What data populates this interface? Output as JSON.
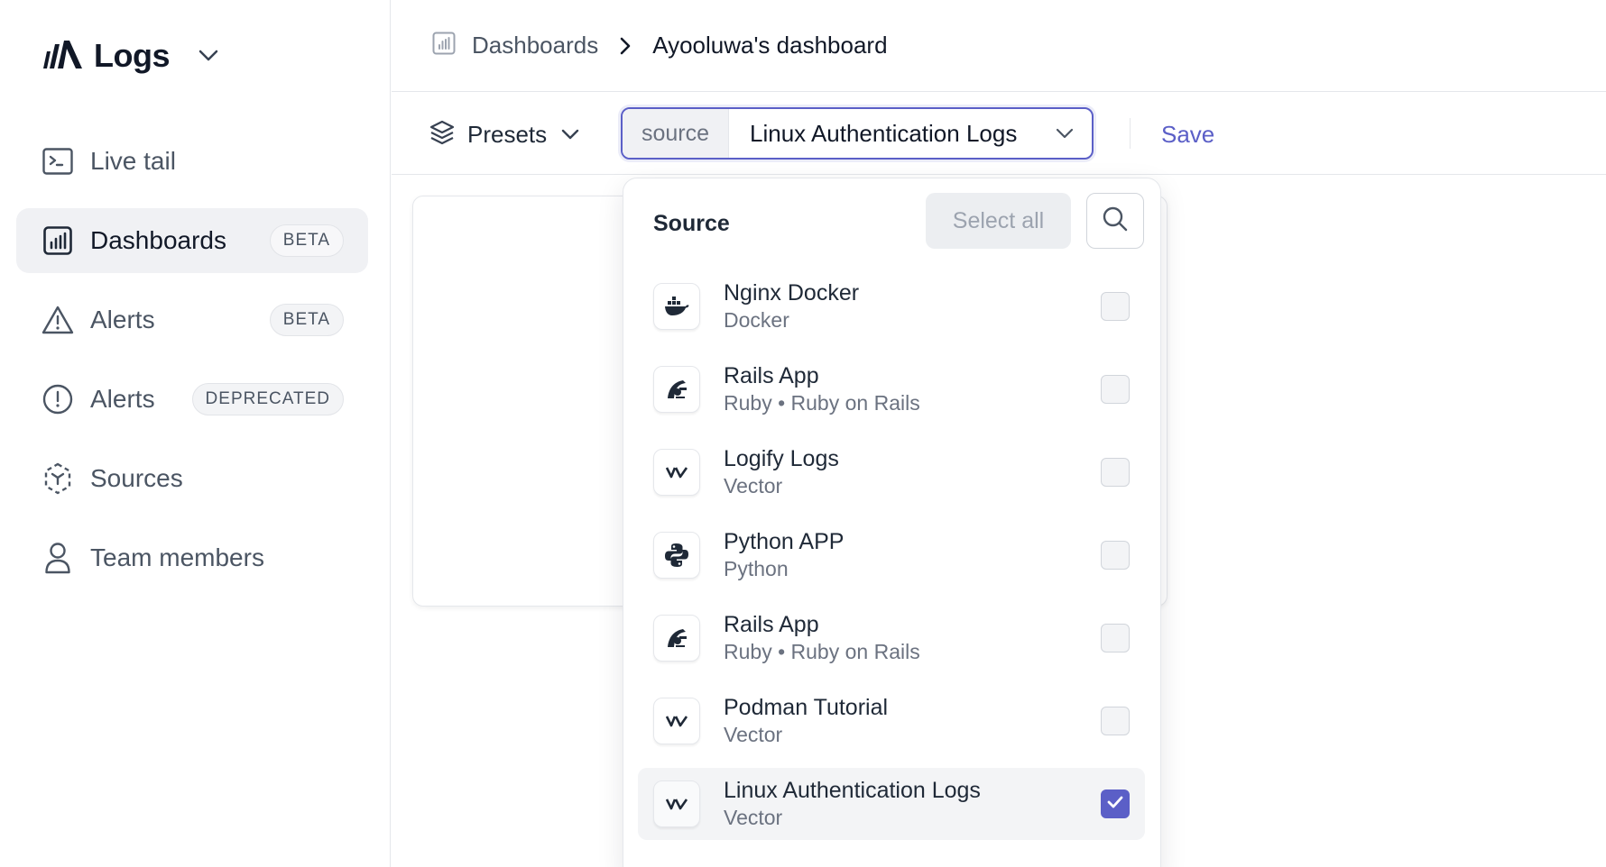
{
  "app": {
    "title": "Logs"
  },
  "sidebar": {
    "items": [
      {
        "label": "Live tail",
        "icon": "terminal-icon",
        "badge": "",
        "active": false
      },
      {
        "label": "Dashboards",
        "icon": "chart-icon",
        "badge": "BETA",
        "active": true
      },
      {
        "label": "Alerts",
        "icon": "warning-icon",
        "badge": "BETA",
        "active": false
      },
      {
        "label": "Alerts",
        "icon": "alert-circle-icon",
        "badge": "DEPRECATED",
        "active": false
      },
      {
        "label": "Sources",
        "icon": "sources-icon",
        "badge": "",
        "active": false
      },
      {
        "label": "Team members",
        "icon": "user-icon",
        "badge": "",
        "active": false
      }
    ]
  },
  "breadcrumb": {
    "parent": "Dashboards",
    "current": "Ayooluwa's dashboard"
  },
  "toolbar": {
    "presets_label": "Presets",
    "source_tag": "source",
    "source_value": "Linux Authentication Logs",
    "save_label": "Save"
  },
  "dropdown": {
    "title": "Source",
    "select_all_label": "Select all",
    "sources": [
      {
        "name": "Nginx Docker",
        "platform": "Docker",
        "icon": "docker-icon",
        "checked": false
      },
      {
        "name": "Rails App",
        "platform": "Ruby • Ruby on Rails",
        "icon": "rails-icon",
        "checked": false
      },
      {
        "name": "Logify Logs",
        "platform": "Vector",
        "icon": "vector-icon",
        "checked": false
      },
      {
        "name": "Python APP",
        "platform": "Python",
        "icon": "python-icon",
        "checked": false
      },
      {
        "name": "Rails App",
        "platform": "Ruby • Ruby on Rails",
        "icon": "rails-icon",
        "checked": false
      },
      {
        "name": "Podman Tutorial",
        "platform": "Vector",
        "icon": "vector-icon",
        "checked": false
      },
      {
        "name": "Linux Authentication Logs",
        "platform": "Vector",
        "icon": "vector-icon",
        "checked": true
      }
    ]
  },
  "colors": {
    "accent": "#5b5fc7",
    "active_bg": "#f0f1f4",
    "border": "#e5e7eb"
  }
}
